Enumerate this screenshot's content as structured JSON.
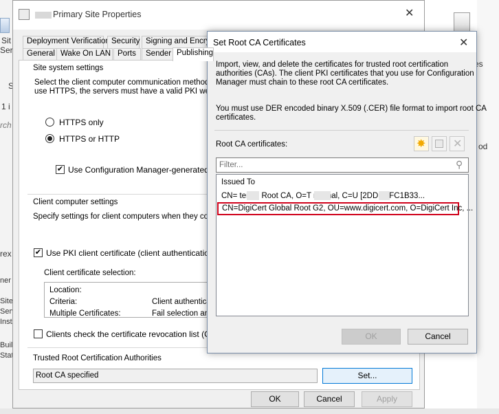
{
  "background": {
    "left_fragments": [
      "Sit",
      "Ser",
      "S",
      "1 i",
      "rch",
      "rex",
      "ner",
      "Site",
      "Serv",
      "Insta",
      "Buil",
      "Stat"
    ],
    "right_fragments": [
      "es",
      "od"
    ]
  },
  "props_dialog": {
    "title": "Primary Site Properties",
    "tabs_row1": [
      "Deployment Verification",
      "Security",
      "Signing and Encryp"
    ],
    "tabs_row2": [
      "General",
      "Wake On LAN",
      "Ports",
      "Sender",
      "Publishing"
    ],
    "site_system_settings": {
      "heading": "Site system settings",
      "description_line1": "Select the client computer communication method (HT",
      "description_line2": "use HTTPS, the servers must have a valid PKI web se",
      "https_only": "HTTPS only",
      "https_or_http": "HTTPS or HTTP",
      "use_cm_certs": "Use Configuration Manager-generated certi"
    },
    "client_settings": {
      "heading": "Client computer settings",
      "description": "Specify settings for client computers when they commu",
      "use_pki": "Use PKI client certificate (client authentication cap",
      "cert_selection_label": "Client certificate selection:",
      "rows": [
        {
          "key": "Location:",
          "value": ""
        },
        {
          "key": "Criteria:",
          "value": "Client authenticat"
        },
        {
          "key": "Multiple Certificates:",
          "value": "Fail selection and"
        }
      ],
      "crl_check": "Clients check the certificate revocation list (CRL) fo"
    },
    "trusted_root": {
      "heading": "Trusted Root Certification Authorities",
      "value": "Root CA specified",
      "set_button": "Set..."
    },
    "buttons": {
      "ok": "OK",
      "cancel": "Cancel",
      "apply": "Apply"
    }
  },
  "root_ca_dialog": {
    "title": "Set Root CA Certificates",
    "description": [
      "Import, view, and delete the certificates for trusted root certification",
      "authorities (CAs). The client PKI certificates that you use for Configuration",
      "Manager must chain to these root CA certificates."
    ],
    "format_note": [
      "You must use DER encoded binary X.509 (.CER) file format to import root CA",
      "certificates."
    ],
    "list_label": "Root CA certificates:",
    "filter_placeholder": "Filter...",
    "column_header": "Issued To",
    "rows": [
      "CN=          ternal Root CA, O=T          nternal, C=U     [2DDECFC1B33...",
      "CN=DigiCert Global Root G2, OU=www.digicert.com, O=DigiCert Inc, ..."
    ],
    "highlight_color": "#d0021b",
    "buttons": {
      "ok": "OK",
      "cancel": "Cancel"
    }
  }
}
